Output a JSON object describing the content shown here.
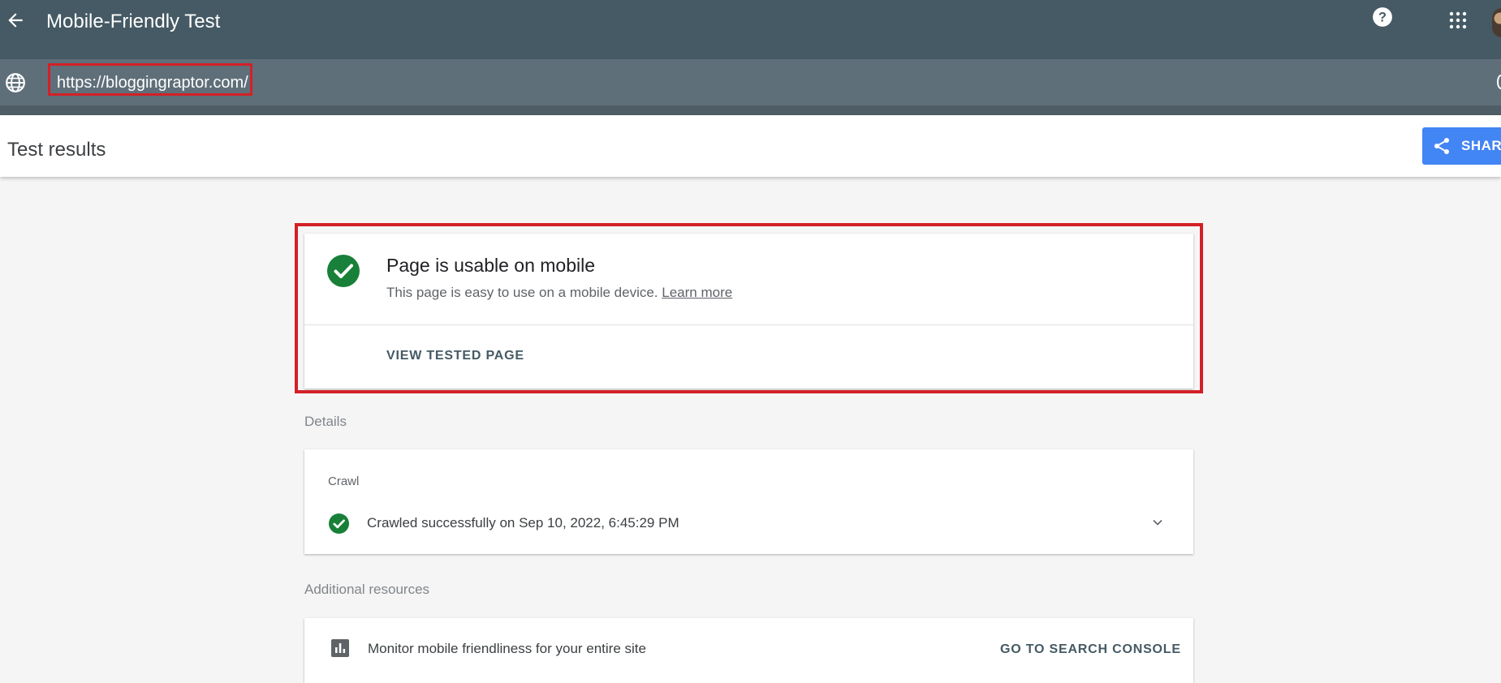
{
  "header": {
    "title": "Mobile-Friendly Test",
    "icons": [
      "back-arrow-icon",
      "help-icon",
      "apps-grid-icon",
      "avatar"
    ]
  },
  "url_bar": {
    "value": "https://bloggingraptor.com/",
    "icon": "globe-icon"
  },
  "subheader": {
    "title": "Test results",
    "share_label": "SHARE"
  },
  "result": {
    "title": "Page is usable on mobile",
    "description": "This page is easy to use on a mobile device.",
    "learn_more": "Learn more",
    "view_tested_page": "VIEW TESTED PAGE",
    "status_color": "#188038"
  },
  "details": {
    "section_label": "Details",
    "crawl_title": "Crawl",
    "crawl_status": "Crawled successfully on Sep 10, 2022, 6:45:29 PM"
  },
  "additional_resources": {
    "section_label": "Additional resources",
    "monitor_text": "Monitor mobile friendliness for your entire site",
    "go_to_console": "GO TO SEARCH CONSOLE"
  },
  "colors": {
    "topbar": "#455a64",
    "urlbar": "#5f6f7a",
    "accent": "#4285f4",
    "highlight": "#d32026",
    "success": "#188038"
  }
}
